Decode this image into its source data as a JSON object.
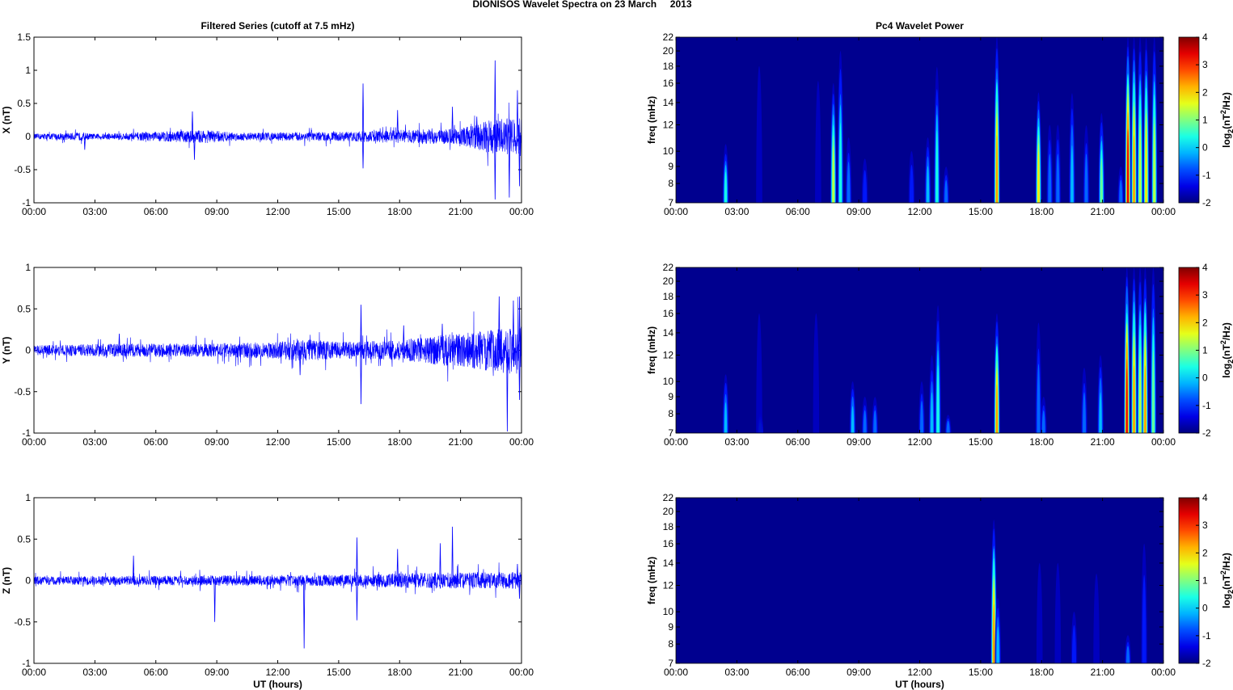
{
  "figure_title": "DIONISOS Wavelet Spectra on 23 March     2013",
  "colors": {
    "trace": "#0000ff",
    "spec_background": "#00008f"
  },
  "chart_data": [
    {
      "type": "line",
      "id": "x-series",
      "title": "Filtered Series (cutoff at 7.5 mHz)",
      "ylabel": "X (nT)",
      "xlabel": "",
      "xlim": [
        0,
        24
      ],
      "ylim": [
        -1,
        1.5
      ],
      "yticks": [
        -1,
        -0.5,
        0,
        0.5,
        1,
        1.5
      ],
      "xticks": [
        "00:00",
        "03:00",
        "06:00",
        "09:00",
        "12:00",
        "15:00",
        "18:00",
        "21:00",
        "00:00"
      ],
      "noise_envelope": [
        [
          0,
          0.04
        ],
        [
          2.4,
          0.06
        ],
        [
          3,
          0.04
        ],
        [
          7.5,
          0.09
        ],
        [
          8.5,
          0.1
        ],
        [
          10,
          0.06
        ],
        [
          15,
          0.07
        ],
        [
          18,
          0.1
        ],
        [
          21,
          0.12
        ],
        [
          22.3,
          0.25
        ],
        [
          24,
          0.3
        ]
      ],
      "spikes": [
        [
          2.5,
          -0.2
        ],
        [
          7.8,
          0.38
        ],
        [
          7.9,
          -0.35
        ],
        [
          16.2,
          0.8
        ],
        [
          16.2,
          -0.48
        ],
        [
          17.9,
          0.4
        ],
        [
          20.6,
          0.45
        ],
        [
          21.8,
          0.3
        ],
        [
          22.7,
          1.15
        ],
        [
          22.7,
          -0.95
        ],
        [
          23.4,
          -0.92
        ],
        [
          23.8,
          0.7
        ],
        [
          23.9,
          -0.75
        ]
      ]
    },
    {
      "type": "line",
      "id": "y-series",
      "title": "",
      "ylabel": "Y (nT)",
      "xlabel": "",
      "xlim": [
        0,
        24
      ],
      "ylim": [
        -1,
        1
      ],
      "yticks": [
        -1,
        -0.5,
        0,
        0.5,
        1
      ],
      "xticks": [
        "00:00",
        "03:00",
        "06:00",
        "09:00",
        "12:00",
        "15:00",
        "18:00",
        "21:00",
        "00:00"
      ],
      "noise_envelope": [
        [
          0,
          0.06
        ],
        [
          4,
          0.08
        ],
        [
          8,
          0.08
        ],
        [
          12,
          0.1
        ],
        [
          13,
          0.14
        ],
        [
          15,
          0.1
        ],
        [
          18,
          0.12
        ],
        [
          22.3,
          0.25
        ],
        [
          24,
          0.3
        ]
      ],
      "spikes": [
        [
          4.2,
          0.2
        ],
        [
          13.1,
          -0.3
        ],
        [
          16.1,
          0.55
        ],
        [
          16.1,
          -0.65
        ],
        [
          18.2,
          0.3
        ],
        [
          20.1,
          0.32
        ],
        [
          22.9,
          0.65
        ],
        [
          23.3,
          -0.98
        ],
        [
          23.6,
          0.6
        ],
        [
          23.9,
          0.65
        ],
        [
          23.9,
          -0.6
        ]
      ]
    },
    {
      "type": "line",
      "id": "z-series",
      "title": "",
      "ylabel": "Z (nT)",
      "xlabel": "UT (hours)",
      "xlim": [
        0,
        24
      ],
      "ylim": [
        -1,
        1
      ],
      "yticks": [
        -1,
        -0.5,
        0,
        0.5,
        1
      ],
      "xticks": [
        "00:00",
        "03:00",
        "06:00",
        "09:00",
        "12:00",
        "15:00",
        "18:00",
        "21:00",
        "00:00"
      ],
      "noise_envelope": [
        [
          0,
          0.05
        ],
        [
          8,
          0.06
        ],
        [
          15,
          0.07
        ],
        [
          18,
          0.09
        ],
        [
          21,
          0.1
        ],
        [
          24,
          0.1
        ]
      ],
      "spikes": [
        [
          4.9,
          0.3
        ],
        [
          8.9,
          -0.5
        ],
        [
          13.3,
          -0.82
        ],
        [
          15.9,
          0.52
        ],
        [
          15.9,
          -0.48
        ],
        [
          17.9,
          0.38
        ],
        [
          20.0,
          0.45
        ],
        [
          20.6,
          0.65
        ],
        [
          23.8,
          0.2
        ],
        [
          23.9,
          -0.22
        ]
      ]
    },
    {
      "type": "heatmap",
      "id": "x-spectrum",
      "title": "Pc4 Wavelet Power",
      "ylabel": "freq (mHz)",
      "xlabel": "",
      "xlim": [
        0,
        24
      ],
      "ylim": [
        7,
        22
      ],
      "yscale": "log",
      "yticks": [
        7,
        8,
        9,
        10,
        12,
        14,
        16,
        18,
        20,
        22
      ],
      "xticks": [
        "00:00",
        "03:00",
        "06:00",
        "09:00",
        "12:00",
        "15:00",
        "18:00",
        "21:00",
        "00:00"
      ],
      "colorbar": {
        "label": "log2(nT2/Hz)",
        "range": [
          -2,
          4
        ],
        "ticks": [
          -2,
          -1,
          0,
          1,
          2,
          3,
          4
        ]
      },
      "events": [
        [
          2.45,
          0.5,
          10.5
        ],
        [
          4.1,
          -1.2,
          18
        ],
        [
          7.0,
          -1.2,
          17
        ],
        [
          7.75,
          1.6,
          16
        ],
        [
          8.1,
          0.4,
          20
        ],
        [
          8.5,
          -0.5,
          11
        ],
        [
          9.3,
          -1,
          9.5
        ],
        [
          11.6,
          -1,
          10
        ],
        [
          12.4,
          0.3,
          11
        ],
        [
          12.85,
          0.5,
          18
        ],
        [
          13.3,
          -0.6,
          9
        ],
        [
          15.8,
          2.6,
          22
        ],
        [
          17.85,
          2.1,
          15
        ],
        [
          18.4,
          -0.2,
          12
        ],
        [
          18.8,
          -0.6,
          12
        ],
        [
          19.5,
          0.2,
          15
        ],
        [
          20.2,
          -0.3,
          12
        ],
        [
          20.95,
          1.3,
          13
        ],
        [
          21.9,
          -0.2,
          9
        ],
        [
          22.25,
          3.5,
          22
        ],
        [
          22.55,
          2.4,
          22
        ],
        [
          22.85,
          1.8,
          22
        ],
        [
          23.15,
          2.2,
          22
        ],
        [
          23.55,
          1.4,
          22
        ]
      ]
    },
    {
      "type": "heatmap",
      "id": "y-spectrum",
      "title": "",
      "ylabel": "freq (mHz)",
      "xlabel": "",
      "xlim": [
        0,
        24
      ],
      "ylim": [
        7,
        22
      ],
      "yscale": "log",
      "yticks": [
        7,
        8,
        9,
        10,
        12,
        14,
        16,
        18,
        20,
        22
      ],
      "xticks": [
        "00:00",
        "03:00",
        "06:00",
        "09:00",
        "12:00",
        "15:00",
        "18:00",
        "21:00",
        "00:00"
      ],
      "colorbar": {
        "label": "log2(nT2/Hz)",
        "range": [
          -2,
          4
        ],
        "ticks": [
          -2,
          -1,
          0,
          1,
          2,
          3,
          4
        ]
      },
      "events": [
        [
          2.45,
          0.3,
          10.5
        ],
        [
          4.15,
          0.2,
          8
        ],
        [
          4.1,
          -1.2,
          16
        ],
        [
          6.9,
          -1.2,
          16
        ],
        [
          8.7,
          0.1,
          10
        ],
        [
          9.3,
          -0.6,
          9
        ],
        [
          9.8,
          -0.6,
          9
        ],
        [
          12.1,
          -0.5,
          10
        ],
        [
          12.6,
          0.2,
          12
        ],
        [
          12.9,
          0.8,
          17
        ],
        [
          13.4,
          -0.6,
          8
        ],
        [
          15.8,
          2.6,
          16
        ],
        [
          17.85,
          -0.2,
          15
        ],
        [
          18.1,
          -0.4,
          9
        ],
        [
          20.1,
          -0.6,
          11
        ],
        [
          20.9,
          0.2,
          12
        ],
        [
          22.2,
          3.5,
          22
        ],
        [
          22.55,
          2.5,
          22
        ],
        [
          22.85,
          1.5,
          22
        ],
        [
          23.1,
          2.4,
          22
        ],
        [
          23.5,
          1.3,
          22
        ]
      ]
    },
    {
      "type": "heatmap",
      "id": "z-spectrum",
      "title": "",
      "ylabel": "freq (mHz)",
      "xlabel": "UT (hours)",
      "xlim": [
        0,
        24
      ],
      "ylim": [
        7,
        22
      ],
      "yscale": "log",
      "yticks": [
        7,
        8,
        9,
        10,
        12,
        14,
        16,
        18,
        20,
        22
      ],
      "xticks": [
        "00:00",
        "03:00",
        "06:00",
        "09:00",
        "12:00",
        "15:00",
        "18:00",
        "21:00",
        "00:00"
      ],
      "colorbar": {
        "label": "log2(nT2/Hz)",
        "range": [
          -2,
          4
        ],
        "ticks": [
          -2,
          -1,
          0,
          1,
          2,
          3,
          4
        ]
      },
      "events": [
        [
          15.65,
          2.5,
          19
        ],
        [
          15.85,
          0.2,
          11
        ],
        [
          17.9,
          -1.4,
          14
        ],
        [
          18.8,
          -1.4,
          14
        ],
        [
          19.6,
          -1.1,
          10
        ],
        [
          20.7,
          -1.4,
          13
        ],
        [
          22.25,
          -0.2,
          8.5
        ],
        [
          23.05,
          -1,
          16
        ]
      ]
    }
  ]
}
